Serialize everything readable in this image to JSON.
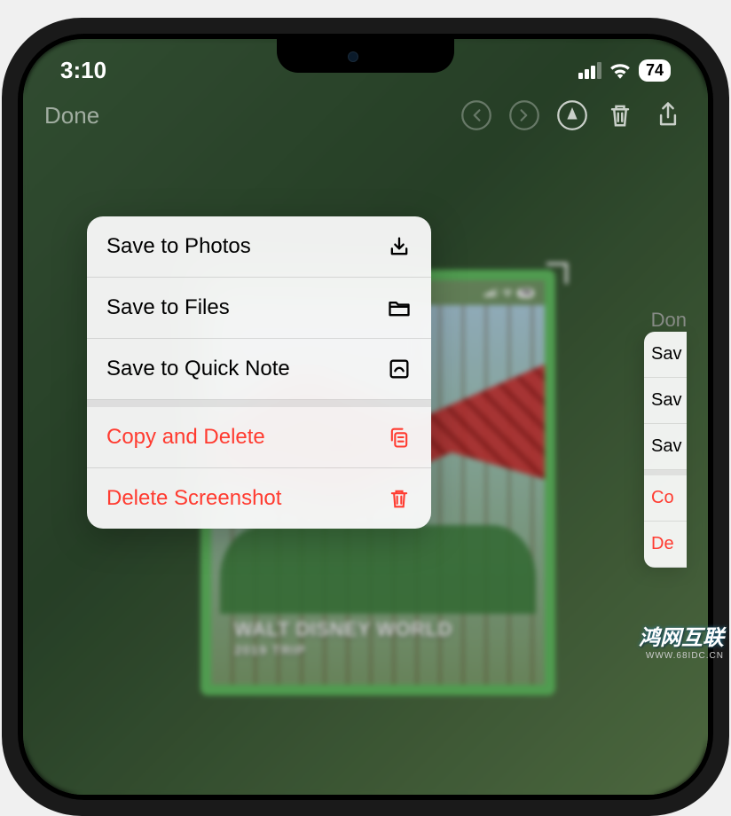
{
  "status": {
    "time": "3:10",
    "battery": "74"
  },
  "toolbar": {
    "done": "Done"
  },
  "menu": {
    "items": [
      {
        "label": "Save to Photos",
        "icon": "download",
        "destructive": false
      },
      {
        "label": "Save to Files",
        "icon": "folder",
        "destructive": false
      },
      {
        "label": "Save to Quick Note",
        "icon": "quicknote",
        "destructive": false
      },
      {
        "label": "Copy and Delete",
        "icon": "copydelete",
        "destructive": true
      },
      {
        "label": "Delete Screenshot",
        "icon": "trash",
        "destructive": true
      }
    ]
  },
  "secondary": {
    "done": "Don",
    "items": [
      "Sav",
      "Sav",
      "Sav",
      "Co",
      "De"
    ]
  },
  "preview": {
    "title": "WALT DISNEY WORLD",
    "subtitle": "2019 TRIP",
    "mini_battery": "74"
  },
  "watermark": {
    "main": "鸿网互联",
    "sub": "WWW.68IDC.CN"
  }
}
